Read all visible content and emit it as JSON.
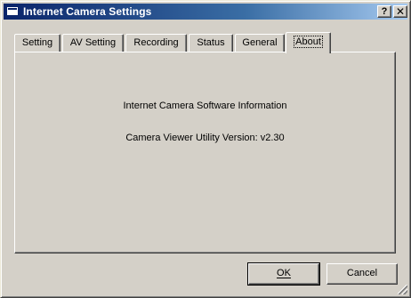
{
  "window": {
    "title": "Internet Camera Settings",
    "help_button": "?",
    "close_button": "✕"
  },
  "tabs": [
    {
      "label": "Setting"
    },
    {
      "label": "AV Setting"
    },
    {
      "label": "Recording"
    },
    {
      "label": "Status"
    },
    {
      "label": "General"
    },
    {
      "label": "About",
      "active": true
    }
  ],
  "about": {
    "line1": "Internet Camera Software Information",
    "line2": "Camera Viewer Utility Version: v2.30"
  },
  "buttons": {
    "ok": "OK",
    "cancel": "Cancel"
  },
  "colors": {
    "title_start": "#0a246a",
    "title_end": "#a6caf0",
    "face": "#d4d0c8"
  }
}
